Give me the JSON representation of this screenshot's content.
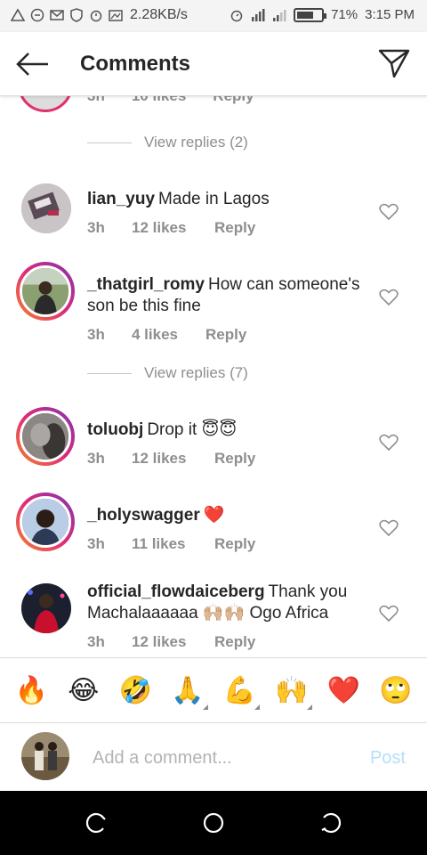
{
  "status_bar": {
    "net_speed": "2.28KB/s",
    "battery_level": 0.71,
    "battery_text": "71%",
    "clock": "3:15 PM"
  },
  "header": {
    "title": "Comments",
    "back_icon": "arrow-left-icon",
    "send_icon": "paper-plane-icon"
  },
  "partial_comment": {
    "time": "3h",
    "likes": "10 likes",
    "reply": "Reply"
  },
  "view_replies_1": "View replies (2)",
  "comments": [
    {
      "username": "lian_yuy",
      "text": "Made in Lagos",
      "time": "3h",
      "likes": "12 likes",
      "reply": "Reply"
    },
    {
      "username": "_thatgirl_romy",
      "text": "How can someone's son be this fine",
      "time": "3h",
      "likes": "4 likes",
      "reply": "Reply"
    },
    {
      "username": "toluobj",
      "text": "Drop it 😇😇",
      "time": "3h",
      "likes": "12 likes",
      "reply": "Reply"
    },
    {
      "username": "_holyswagger",
      "text": "❤️",
      "time": "3h",
      "likes": "11 likes",
      "reply": "Reply"
    },
    {
      "username": "official_flowdaiceberg",
      "text": "Thank you Machalaaaaaa 🙌🏼🙌🏼 Ogo Africa",
      "time": "3h",
      "likes": "12 likes",
      "reply": "Reply"
    }
  ],
  "view_replies_2": "View replies (7)",
  "emoji_bar": [
    "🔥",
    "😂",
    "🤣",
    "🙏",
    "💪",
    "🙌",
    "❤️",
    "🙄"
  ],
  "composer": {
    "placeholder": "Add a comment...",
    "post_label": "Post"
  },
  "colors": {
    "link_blue_disabled": "#b2dffc",
    "secondary_text": "#8e8e8e",
    "heart_red": "#e0245e"
  }
}
